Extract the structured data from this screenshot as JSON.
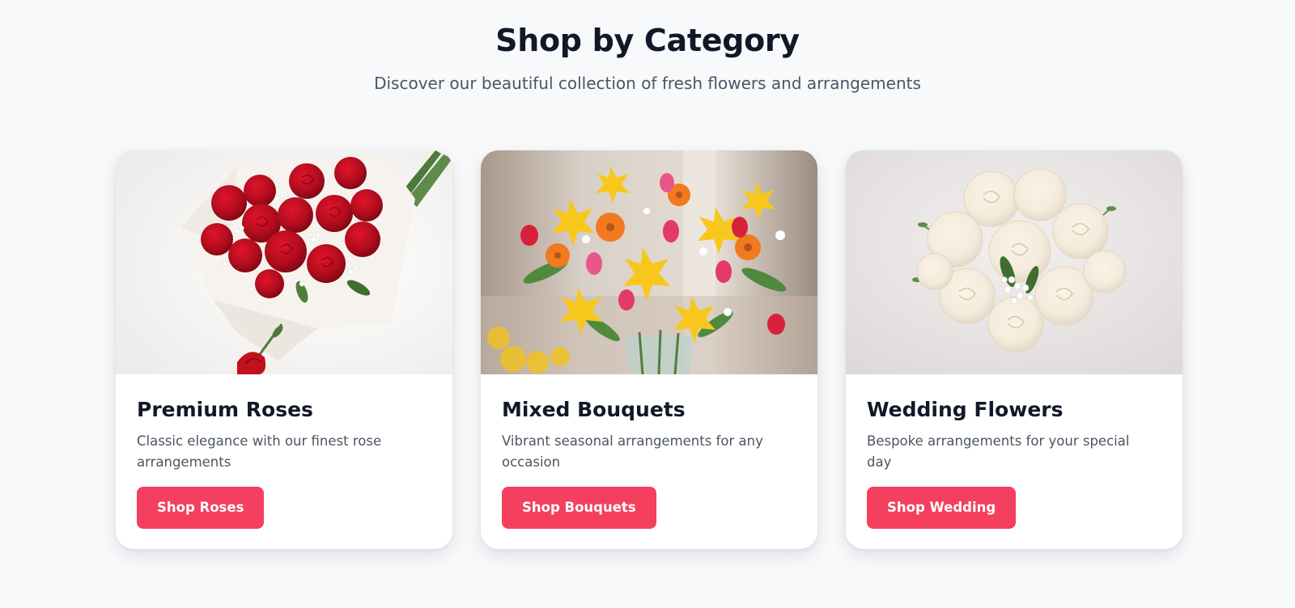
{
  "section": {
    "title": "Shop by Category",
    "subtitle": "Discover our beautiful collection of fresh flowers and arrangements"
  },
  "cards": [
    {
      "image_subject": "red-rose-bouquet",
      "title": "Premium Roses",
      "description": "Classic elegance with our finest rose arrangements",
      "button_label": "Shop Roses"
    },
    {
      "image_subject": "mixed-flower-vase",
      "title": "Mixed Bouquets",
      "description": "Vibrant seasonal arrangements for any occasion",
      "button_label": "Shop Bouquets"
    },
    {
      "image_subject": "white-rose-bridal-bouquet",
      "title": "Wedding Flowers",
      "description": "Bespoke arrangements for your special day",
      "button_label": "Shop Wedding"
    }
  ],
  "colors": {
    "accent": "#f43f5e",
    "background": "#f8f9fb",
    "card": "#ffffff",
    "heading": "#111827",
    "body_text": "#4b5563"
  }
}
